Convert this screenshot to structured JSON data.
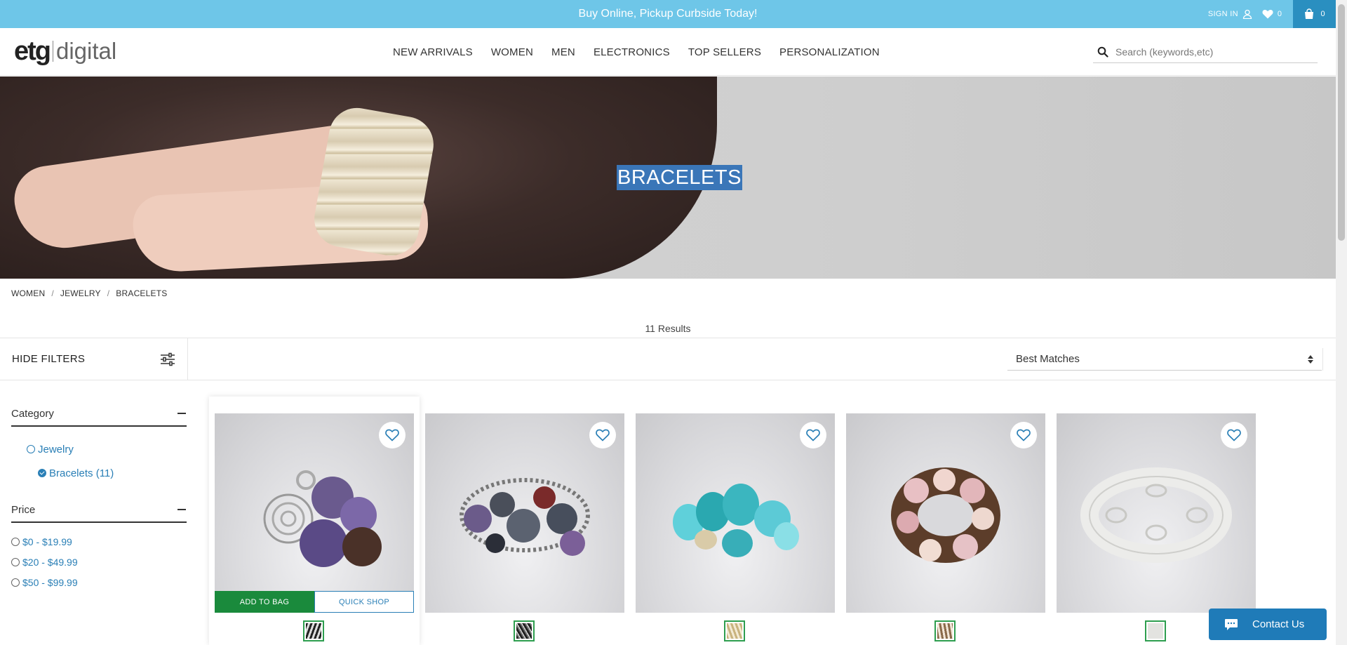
{
  "promo": {
    "text": "Buy Online, Pickup Curbside Today!"
  },
  "account": {
    "signin_label": "SIGN IN",
    "wishlist_count": "0",
    "cart_count": "0"
  },
  "logo": {
    "left": "etg",
    "right": "digital"
  },
  "nav": [
    "NEW ARRIVALS",
    "WOMEN",
    "MEN",
    "ELECTRONICS",
    "TOP SELLERS",
    "PERSONALIZATION"
  ],
  "search": {
    "placeholder": "Search (keywords,etc)",
    "value": ""
  },
  "hero": {
    "title": "BRACELETS"
  },
  "breadcrumb": [
    "WOMEN",
    "JEWELRY",
    "BRACELETS"
  ],
  "results": "11 Results",
  "filters": {
    "hide_label": "HIDE FILTERS",
    "sort_selected": "Best Matches"
  },
  "facets": {
    "category": {
      "title": "Category",
      "items": [
        {
          "label": "Jewelry",
          "checked": false
        },
        {
          "label": "Bracelets (11)",
          "checked": true
        }
      ]
    },
    "price": {
      "title": "Price",
      "items": [
        "$0 - $19.99",
        "$20 - $49.99",
        "$50 - $99.99"
      ]
    }
  },
  "product_actions": {
    "add_to_bag": "ADD TO BAG",
    "quick_shop": "QUICK SHOP"
  },
  "products": [
    {
      "name": "purple-disc-bracelet"
    },
    {
      "name": "dark-bead-bracelet"
    },
    {
      "name": "turquoise-bracelet"
    },
    {
      "name": "pink-bead-bracelet"
    },
    {
      "name": "silver-link-bracelet"
    }
  ],
  "chat": {
    "label": "Contact Us"
  },
  "colors": {
    "promo_bg": "#6ec6e8",
    "cart_bg": "#2a8fc0",
    "link": "#2a7fb6",
    "add_to_bag": "#1a8a3c",
    "chat_bg": "#1f7bb8"
  }
}
